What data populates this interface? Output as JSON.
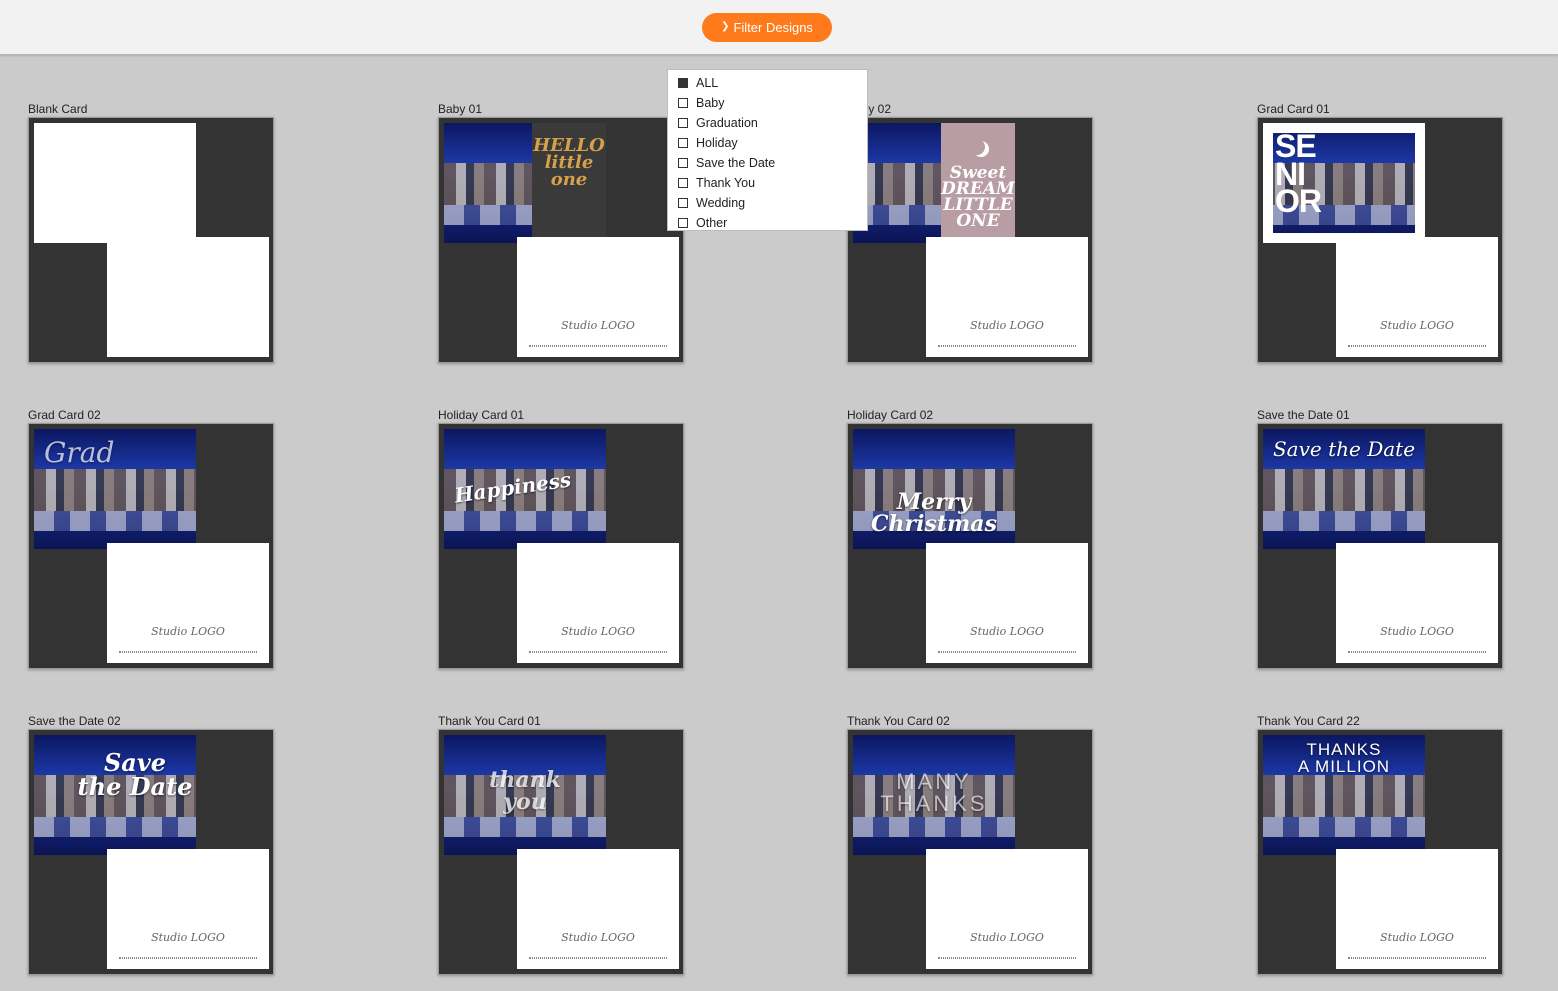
{
  "toolbar": {
    "filter_label": "Filter Designs"
  },
  "filter_options": [
    {
      "label": "ALL",
      "checked": true
    },
    {
      "label": "Baby",
      "checked": false
    },
    {
      "label": "Graduation",
      "checked": false
    },
    {
      "label": "Holiday",
      "checked": false
    },
    {
      "label": "Save the Date",
      "checked": false
    },
    {
      "label": "Thank You",
      "checked": false
    },
    {
      "label": "Wedding",
      "checked": false
    },
    {
      "label": "Other",
      "checked": false
    }
  ],
  "cards": [
    {
      "title": "Blank Card"
    },
    {
      "title": "Baby 01"
    },
    {
      "title": "Baby 02"
    },
    {
      "title": "Grad Card 01"
    },
    {
      "title": "Grad Card 02"
    },
    {
      "title": "Holiday Card 01"
    },
    {
      "title": "Holiday Card 02"
    },
    {
      "title": "Save the Date 01"
    },
    {
      "title": "Save the Date 02"
    },
    {
      "title": "Thank You Card 01"
    },
    {
      "title": "Thank You Card 02"
    },
    {
      "title": "Thank You Card 22"
    }
  ],
  "card_art": {
    "baby01": "HELLO\nlittle\none",
    "baby02": "Sweet\nDREAMS\nLITTLE ONE",
    "grad01": "SE\nNI\nOR",
    "grad02": "Grad",
    "holiday01": "Happiness",
    "holiday02": "Merry\nChristmas",
    "std01": "Save the Date",
    "std02": "Save\nthe Date",
    "ty01": "thank\nyou",
    "ty02": "MANY\nTHANKS",
    "ty22": "THANKS\nA MILLION",
    "logo": "Studio LOGO"
  },
  "colors": {
    "accent": "#ff7a1a",
    "background": "#cbcbcb",
    "card_bg": "#333333"
  },
  "icons": {
    "filter": "chevron-down-icon",
    "option": "checkbox-icon"
  }
}
